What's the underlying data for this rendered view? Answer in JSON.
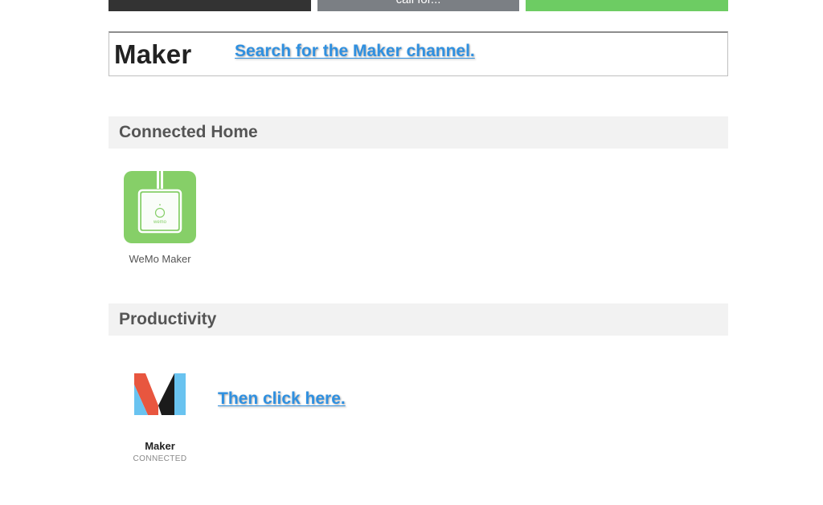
{
  "top_bars": {
    "dark_label": "",
    "gray_label": "call for...",
    "green_label": ""
  },
  "search": {
    "value": "Maker",
    "annotation": "Search for the Maker channel."
  },
  "sections": [
    {
      "title": "Connected Home",
      "items": [
        {
          "label": "WeMo Maker",
          "icon": "wemo-maker-icon",
          "icon_text": "wemo"
        }
      ]
    },
    {
      "title": "Productivity",
      "items": [
        {
          "label": "Maker",
          "status": "CONNECTED",
          "icon": "maker-logo-icon"
        }
      ]
    }
  ],
  "click_annotation": "Then click here.",
  "colors": {
    "annotation_blue": "#2f90e0",
    "wemo_green": "#86cf68",
    "top_green": "#6dcc63",
    "maker_red": "#e8563f",
    "maker_blue": "#69c3f0",
    "maker_black": "#1b1b1b"
  }
}
